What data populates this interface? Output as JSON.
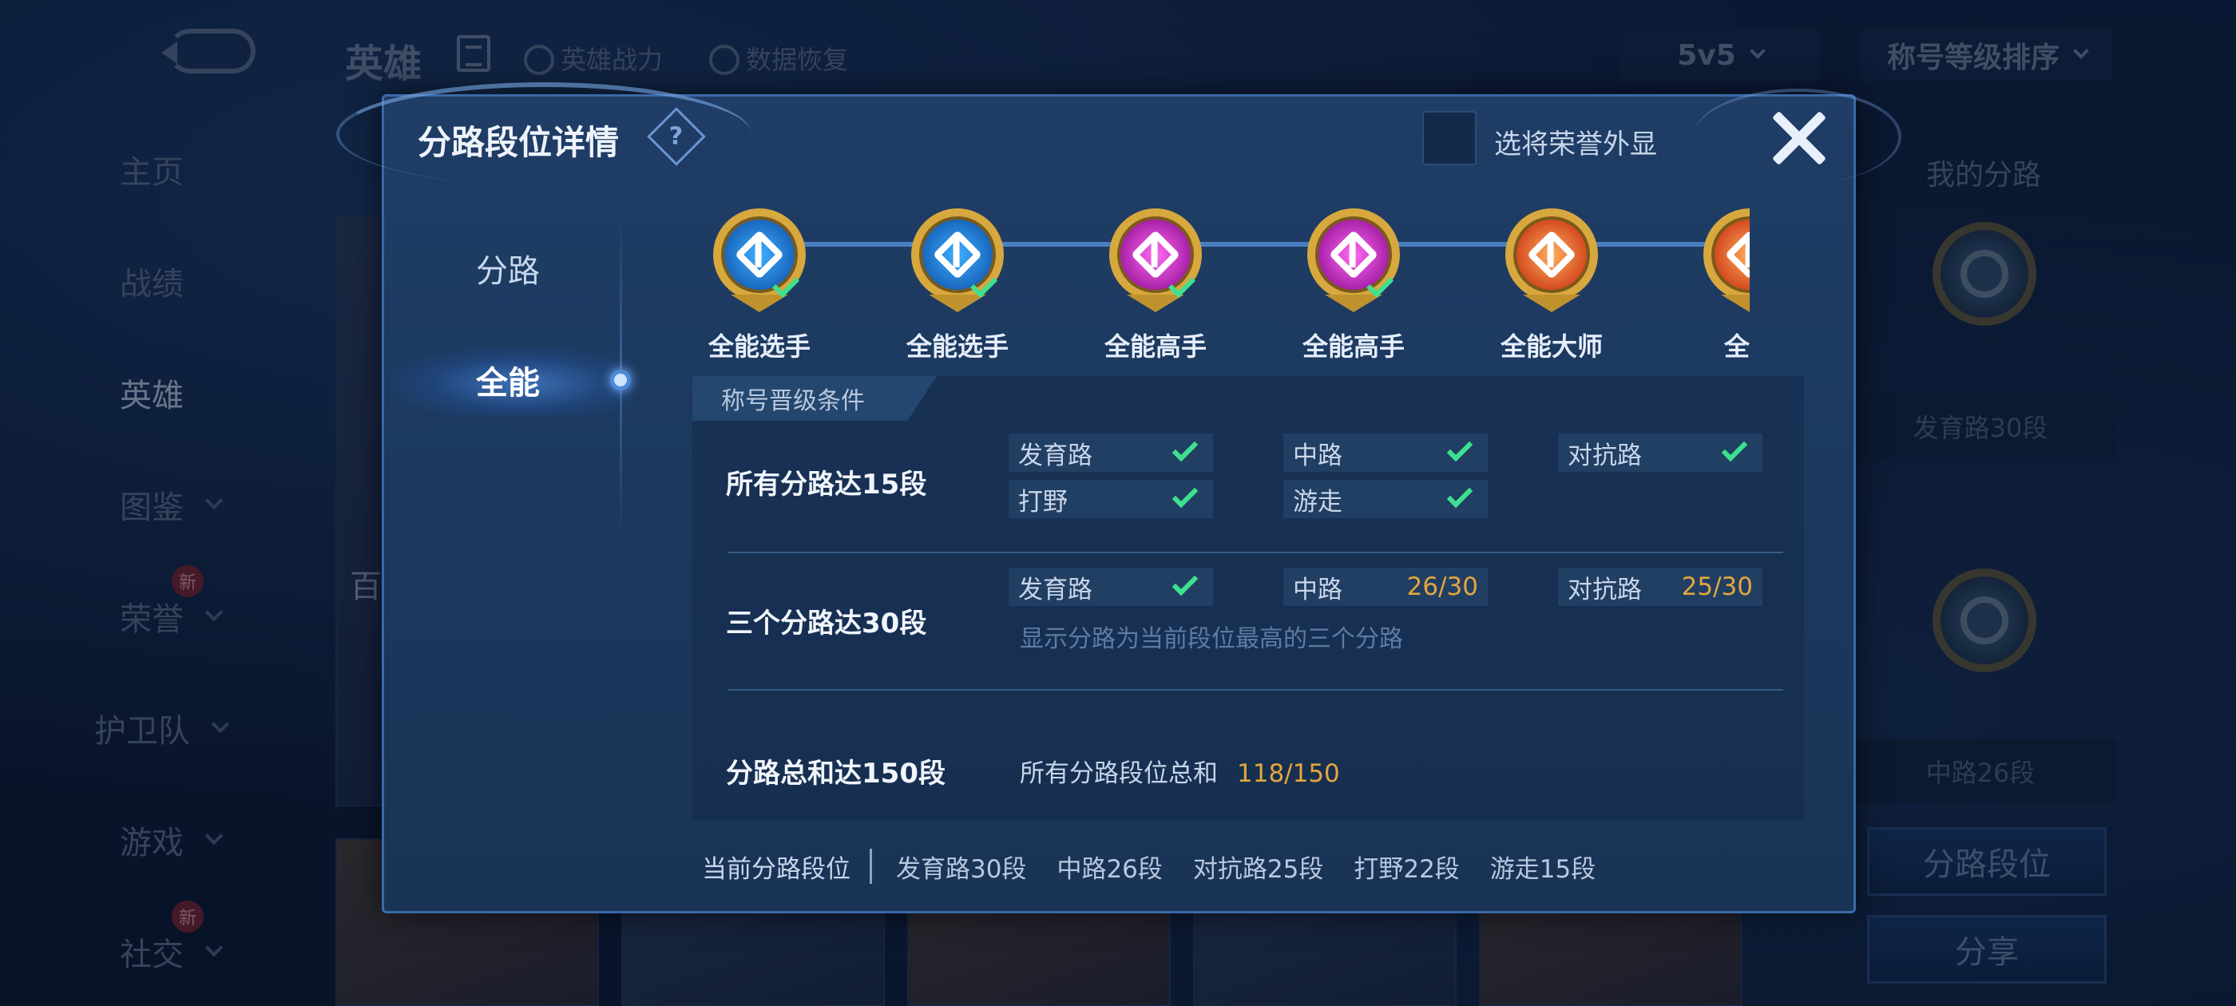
{
  "topbar": {
    "title": "英雄",
    "links": [
      "英雄战力",
      "数据恢复"
    ],
    "mode": "5v5",
    "sort": "称号等级排序"
  },
  "leftnav": {
    "items": [
      "主页",
      "战绩",
      "英雄",
      "图鉴",
      "荣誉",
      "护卫队",
      "游戏",
      "社交"
    ],
    "badge": "新"
  },
  "background": {
    "hero_partial_text": "百"
  },
  "right_panel": {
    "title": "我的分路",
    "road1_label": "发育路30段",
    "road2_label": "中路26段",
    "btn_rank": "分路段位",
    "btn_share": "分享"
  },
  "modal": {
    "title": "分路段位详情",
    "help": "?",
    "honor_label": "选将荣誉外显",
    "tabs": {
      "road": "分路",
      "all": "全能"
    },
    "emblems": [
      {
        "name": "全能选手",
        "tier": "blue",
        "achieved": true
      },
      {
        "name": "全能选手",
        "tier": "blue",
        "achieved": true
      },
      {
        "name": "全能高手",
        "tier": "purple",
        "achieved": true
      },
      {
        "name": "全能高手",
        "tier": "purple",
        "achieved": true
      },
      {
        "name": "全能大师",
        "tier": "orange",
        "achieved": false
      },
      {
        "name": "全能",
        "tier": "orange",
        "achieved": false
      }
    ],
    "conditions": {
      "header": "称号晋级条件",
      "row1": {
        "label": "所有分路达15段",
        "chips": [
          "发育路",
          "中路",
          "对抗路",
          "打野",
          "游走"
        ]
      },
      "row2": {
        "label": "三个分路达30段",
        "chip1": "发育路",
        "chip2": "中路",
        "chip2_val": "26/30",
        "chip3": "对抗路",
        "chip3_val": "25/30",
        "note": "显示分路为当前段位最高的三个分路"
      },
      "row3": {
        "label": "分路总和达150段",
        "text": "所有分路段位总和",
        "value": "118/150"
      }
    },
    "footer": {
      "lead": "当前分路段位",
      "segments": [
        "发育路30段",
        "中路26段",
        "对抗路25段",
        "打野22段",
        "游走15段"
      ]
    }
  },
  "colors": {
    "accent_check": "#3ee08f",
    "progress": "#e3a63e",
    "modal_bg": "#1f3d66"
  }
}
